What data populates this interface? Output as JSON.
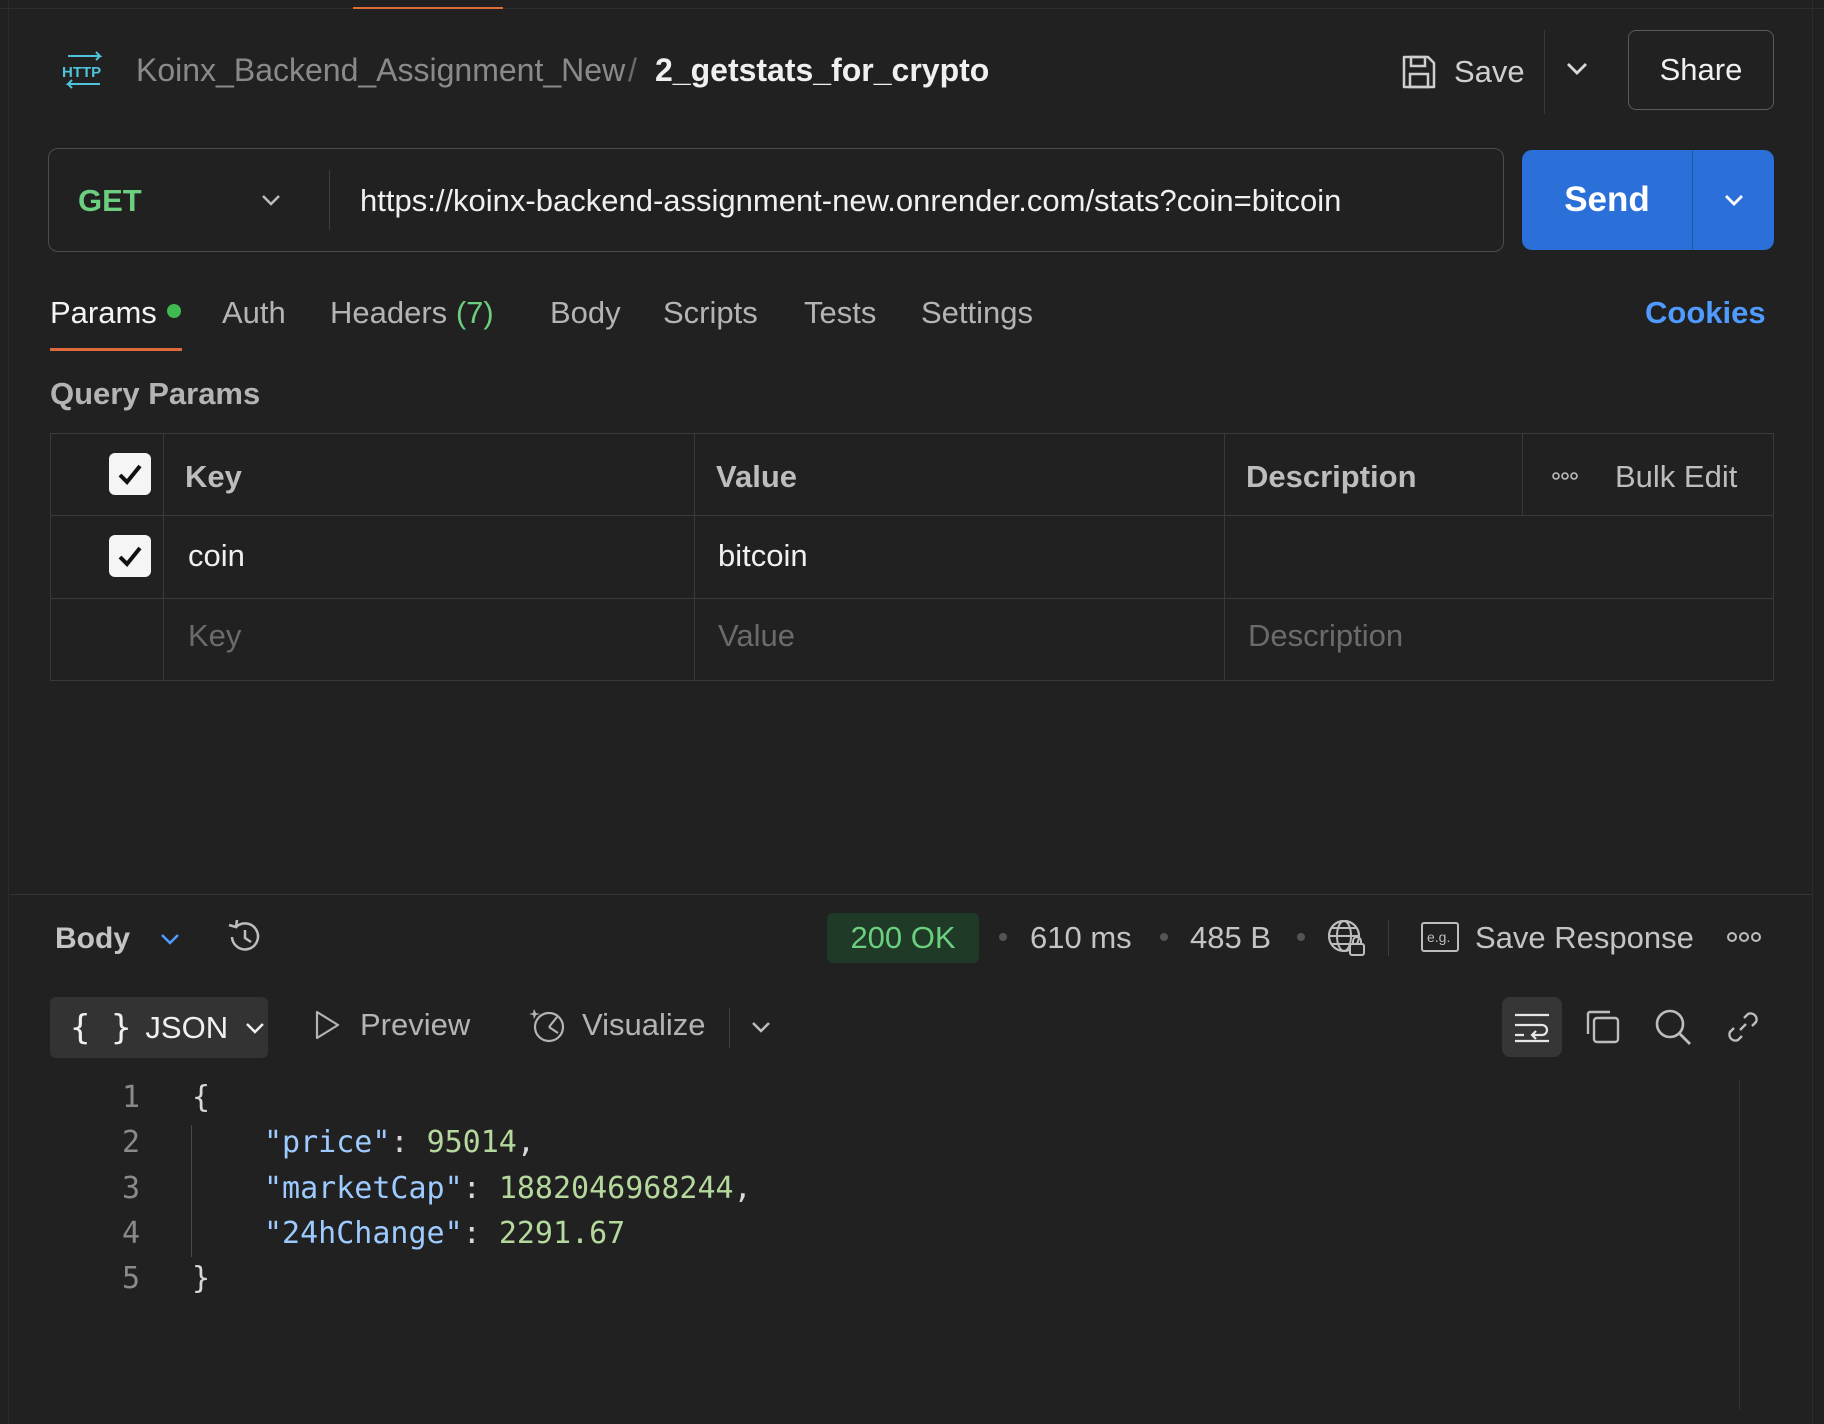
{
  "header": {
    "collection": "Koinx_Backend_Assignment_New",
    "separator": "/",
    "request_name": "2_getstats_for_crypto",
    "save_label": "Save",
    "share_label": "Share"
  },
  "request": {
    "method": "GET",
    "url": "https://koinx-backend-assignment-new.onrender.com/stats?coin=bitcoin",
    "send_label": "Send"
  },
  "tabs": {
    "params": "Params",
    "auth": "Auth",
    "headers": "Headers",
    "headers_count": "(7)",
    "body": "Body",
    "scripts": "Scripts",
    "tests": "Tests",
    "settings": "Settings",
    "cookies": "Cookies"
  },
  "params": {
    "title": "Query Params",
    "columns": {
      "key": "Key",
      "value": "Value",
      "description": "Description"
    },
    "bulk_edit": "Bulk Edit",
    "rows": [
      {
        "key": "coin",
        "value": "bitcoin",
        "description": ""
      }
    ],
    "placeholders": {
      "key": "Key",
      "value": "Value",
      "description": "Description"
    }
  },
  "response": {
    "body_label": "Body",
    "status": "200 OK",
    "time": "610 ms",
    "size": "485 B",
    "save_response": "Save Response",
    "format": "JSON",
    "preview": "Preview",
    "visualize": "Visualize",
    "lines": {
      "n1": "1",
      "n2": "2",
      "n3": "3",
      "n4": "4",
      "n5": "5",
      "open": "{",
      "price_key": "\"price\"",
      "price_val": "95014",
      "cap_key": "\"marketCap\"",
      "cap_val": "1882046968244",
      "change_key": "\"24hChange\"",
      "change_val": "2291.67",
      "close": "}"
    }
  },
  "colors": {
    "accent_orange": "#e06a3c",
    "send_blue": "#2b6fd8",
    "method_green": "#6bcf7f",
    "status_bg": "#1f3a26",
    "cookies_blue": "#4f9bff"
  }
}
